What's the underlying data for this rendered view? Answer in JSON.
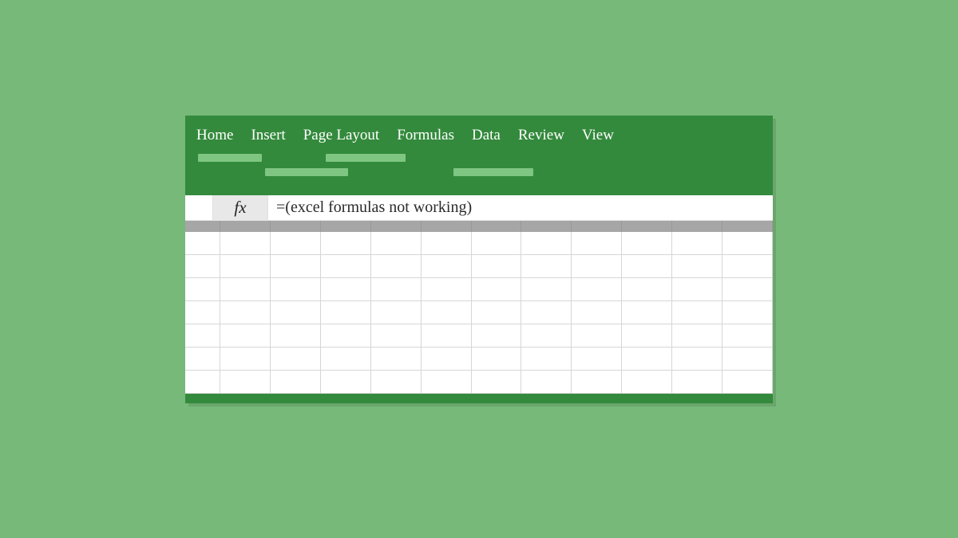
{
  "tabs": {
    "home": "Home",
    "insert": "Insert",
    "page_layout": "Page Layout",
    "formulas": "Formulas",
    "data": "Data",
    "review": "Review",
    "view": "View"
  },
  "formula_bar": {
    "fx_label": "fx",
    "value": "=(excel formulas not working)"
  },
  "grid": {
    "columns": 11,
    "rows": 7
  },
  "colors": {
    "page_bg": "#76b979",
    "window_bg": "#338a3c",
    "placeholder": "#7fc683",
    "header_gray": "#a6a6a6"
  }
}
